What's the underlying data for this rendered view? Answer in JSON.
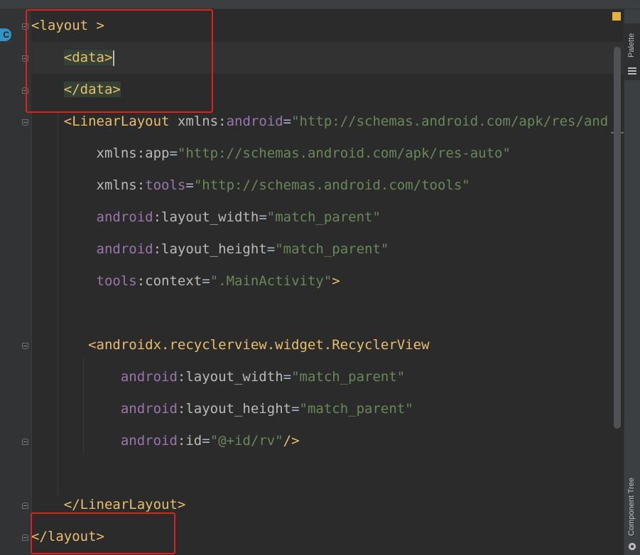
{
  "editor": {
    "lines": [
      [
        {
          "t": "<layout >",
          "c": "tag"
        }
      ],
      [
        {
          "t": "    "
        },
        {
          "t": "<data>",
          "c": "tag hl"
        },
        {
          "caret": true
        }
      ],
      [
        {
          "t": "    "
        },
        {
          "t": "</data>",
          "c": "tag hl"
        }
      ],
      [
        {
          "t": "    "
        },
        {
          "t": "<LinearLayout ",
          "c": "tag"
        },
        {
          "t": "xmlns:",
          "c": "attr"
        },
        {
          "t": "android",
          "c": "ns"
        },
        {
          "t": "=",
          "c": "punct"
        },
        {
          "t": "\"http://schemas.android.com/apk/res/and",
          "c": "val"
        }
      ],
      [
        {
          "t": "        "
        },
        {
          "t": "xmlns:app",
          "c": "attr"
        },
        {
          "t": "=",
          "c": "punct"
        },
        {
          "t": "\"http://schemas.android.com/apk/res-auto\"",
          "c": "val"
        }
      ],
      [
        {
          "t": "        "
        },
        {
          "t": "xmlns:",
          "c": "attr"
        },
        {
          "t": "tools",
          "c": "ns"
        },
        {
          "t": "=",
          "c": "punct"
        },
        {
          "t": "\"http://schemas.android.com/tools\"",
          "c": "val"
        }
      ],
      [
        {
          "t": "        "
        },
        {
          "t": "android",
          "c": "ns"
        },
        {
          "t": ":layout_width",
          "c": "attr"
        },
        {
          "t": "=",
          "c": "punct"
        },
        {
          "t": "\"match_parent\"",
          "c": "val"
        }
      ],
      [
        {
          "t": "        "
        },
        {
          "t": "android",
          "c": "ns"
        },
        {
          "t": ":layout_height",
          "c": "attr"
        },
        {
          "t": "=",
          "c": "punct"
        },
        {
          "t": "\"match_parent\"",
          "c": "val"
        }
      ],
      [
        {
          "t": "        "
        },
        {
          "t": "tools",
          "c": "ns"
        },
        {
          "t": ":context",
          "c": "attr"
        },
        {
          "t": "=",
          "c": "punct"
        },
        {
          "t": "\".MainActivity\"",
          "c": "val"
        },
        {
          "t": ">",
          "c": "tag"
        }
      ],
      [],
      [
        {
          "t": "       "
        },
        {
          "t": "<androidx.recyclerview.widget.RecyclerView",
          "c": "tag"
        }
      ],
      [
        {
          "t": "           "
        },
        {
          "t": "android",
          "c": "ns"
        },
        {
          "t": ":layout_width",
          "c": "attr"
        },
        {
          "t": "=",
          "c": "punct"
        },
        {
          "t": "\"match_parent\"",
          "c": "val"
        }
      ],
      [
        {
          "t": "           "
        },
        {
          "t": "android",
          "c": "ns"
        },
        {
          "t": ":layout_height",
          "c": "attr"
        },
        {
          "t": "=",
          "c": "punct"
        },
        {
          "t": "\"match_parent\"",
          "c": "val"
        }
      ],
      [
        {
          "t": "           "
        },
        {
          "t": "android",
          "c": "ns"
        },
        {
          "t": ":id",
          "c": "attr"
        },
        {
          "t": "=",
          "c": "punct"
        },
        {
          "t": "\"@+id/rv\"",
          "c": "val"
        },
        {
          "t": "/>",
          "c": "tag"
        }
      ],
      [],
      [
        {
          "t": "    "
        },
        {
          "t": "</LinearLayout>",
          "c": "tag"
        }
      ],
      [
        {
          "t": "</layout>",
          "c": "tag"
        }
      ]
    ]
  },
  "gutter": {
    "class_badge": "C"
  },
  "right_panel": {
    "palette_label": "Palette",
    "component_tree_label": "Component Tree"
  },
  "colors": {
    "background": "#2b2b2b",
    "tag": "#e8bf6a",
    "namespace": "#9876aa",
    "attribute": "#bababa",
    "string_value": "#6a8759",
    "tag_highlight": "#344134",
    "annotation_box": "#e0201b"
  }
}
